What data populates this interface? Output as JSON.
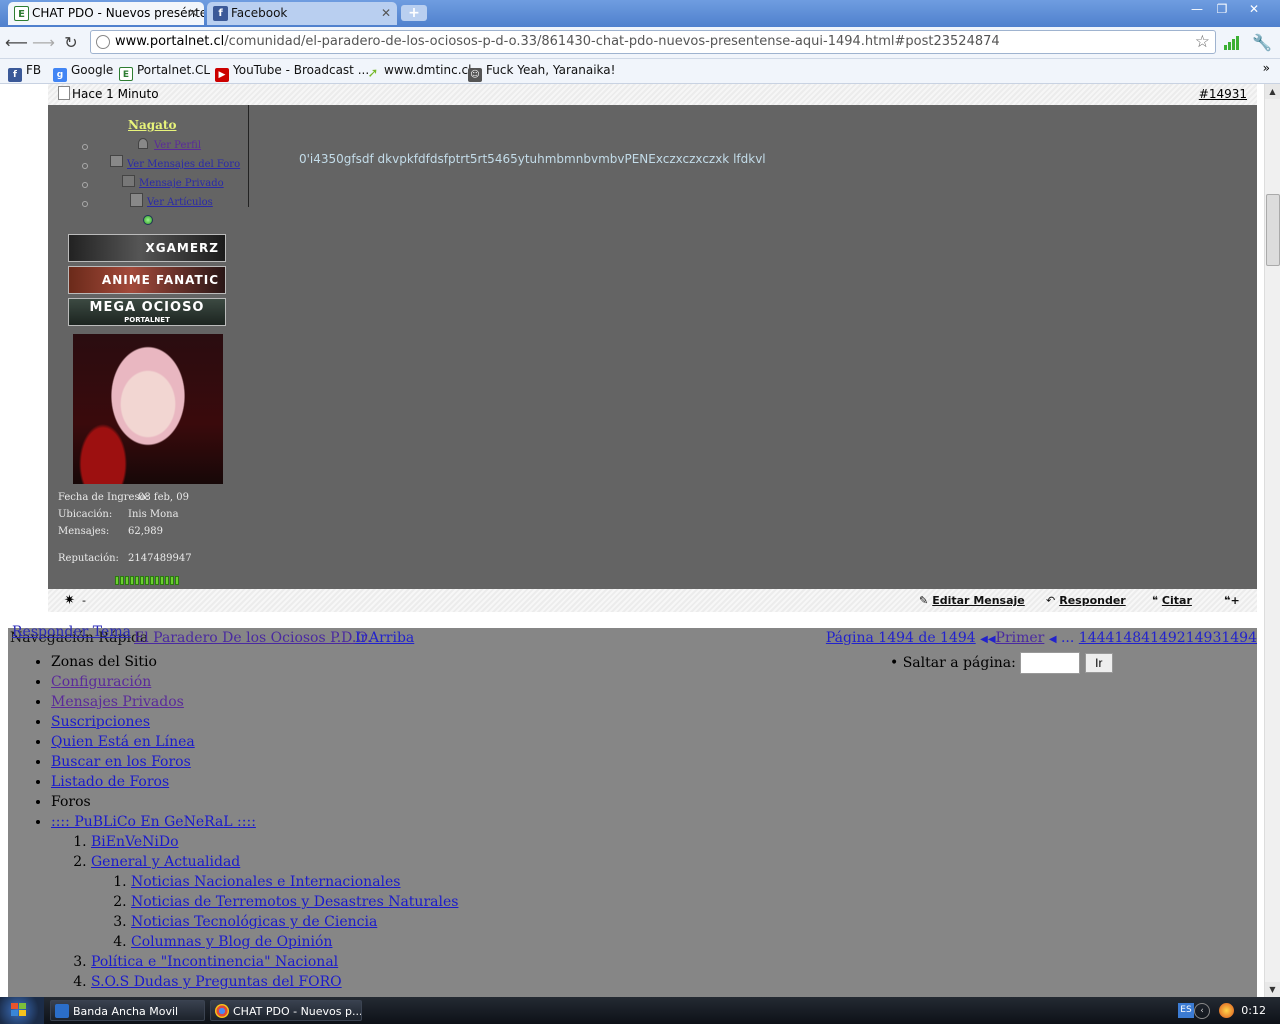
{
  "browser": {
    "tabs": [
      {
        "title": "CHAT PDO - Nuevos preséntense aquí",
        "active": true,
        "icon": "portalnet-favicon"
      },
      {
        "title": "Facebook",
        "active": false,
        "icon": "facebook-favicon"
      }
    ],
    "new_tab_label": "+",
    "window_controls": {
      "minimize": "—",
      "restore": "❐",
      "close": "✕"
    },
    "url_host": "www.portalnet.cl",
    "url_path": "/comunidad/el-paradero-de-los-ociosos-p-d-o.33/861430-chat-pdo-nuevos-presentense-aqui-1494.html#post23524874",
    "bookmarks": [
      {
        "label": "FB",
        "icon": "facebook-icon",
        "color": "#3b5998"
      },
      {
        "label": "Google",
        "icon": "google-icon",
        "color": "#4285f4"
      },
      {
        "label": "Portalnet.CL",
        "icon": "portalnet-icon",
        "color": "#2e7d32"
      },
      {
        "label": "YouTube - Broadcast ...",
        "icon": "youtube-icon",
        "color": "#cc0000"
      },
      {
        "label": "www.dmtinc.cl",
        "icon": "arrow-icon",
        "color": "#76b82a"
      },
      {
        "label": "Fuck Yeah, Yaranaika!",
        "icon": "tumblr-avatar-icon",
        "color": "#555555"
      }
    ],
    "bookmarks_more": "»"
  },
  "post": {
    "time": "Hace 1 Minuto",
    "number": "#14931",
    "user": {
      "name": "Nagato",
      "menu": [
        "Ver Perfil",
        "Ver Mensajes del Foro",
        "Mensaje Privado",
        "Ver Artículos"
      ],
      "badges": [
        "XGAMERZ",
        "ANIME FANATIC",
        "MEGA OCIOSO"
      ],
      "badge3_sub": "PORTALNET",
      "info": [
        {
          "label": "Fecha de Ingreso:",
          "value": "08 feb, 09"
        },
        {
          "label": "Ubicación:",
          "value": "Inis Mona"
        },
        {
          "label": "Mensajes:",
          "value": "62,989"
        },
        {
          "label": "Reputación:",
          "value": "2147489947"
        }
      ],
      "reputation_pips": 13
    },
    "message": "0'i4350gfsdf dkvpkfdfdsfptrt5rt5465ytuhmbmnbvmbvPENExczxczxczxk lfdkvl",
    "footer": {
      "dash": "-",
      "edit": "Editar Mensaje",
      "reply": "Responder",
      "quote": "Citar"
    }
  },
  "thread_nav": {
    "reply_topic": "Responder Tema",
    "quick_nav": "Navegación Rápida",
    "forum_link": "El Paradero De los Ociosos P.D.O.",
    "go": "Ir",
    "top": "Arriba",
    "page_info": "Página 1494 de 1494",
    "first": "Primer",
    "ellipsis": "...",
    "pages": [
      "1444",
      "1484",
      "1492",
      "1493",
      "1494"
    ]
  },
  "site_menu": {
    "zones_heading": "Zonas del Sitio",
    "zones": [
      "Configuración",
      "Mensajes Privados",
      "Suscripciones",
      "Quien Está en Línea",
      "Buscar en los Foros",
      "Listado de Foros"
    ],
    "forums_heading": "Foros",
    "category": ":::: PuBLiCo En GeNeRaL ::::",
    "forums": [
      "BiEnVeNiDo",
      "General y Actualidad"
    ],
    "subforums": [
      "Noticias Nacionales e Internacionales",
      "Noticias de Terremotos y Desastres Naturales",
      "Noticias Tecnológicas y de Ciencia",
      "Columnas y Blog de Opinión"
    ],
    "more_forums": [
      "Política e \"Incontinencia\" Nacional",
      "S.O.S Dudas y Preguntas del FORO"
    ],
    "jump_label": "Saltar a página:",
    "jump_button": "Ir"
  },
  "taskbar": {
    "tasks": [
      "Banda Ancha Movil",
      "CHAT PDO - Nuevos p..."
    ],
    "lang": "ES",
    "time": "0:12"
  }
}
